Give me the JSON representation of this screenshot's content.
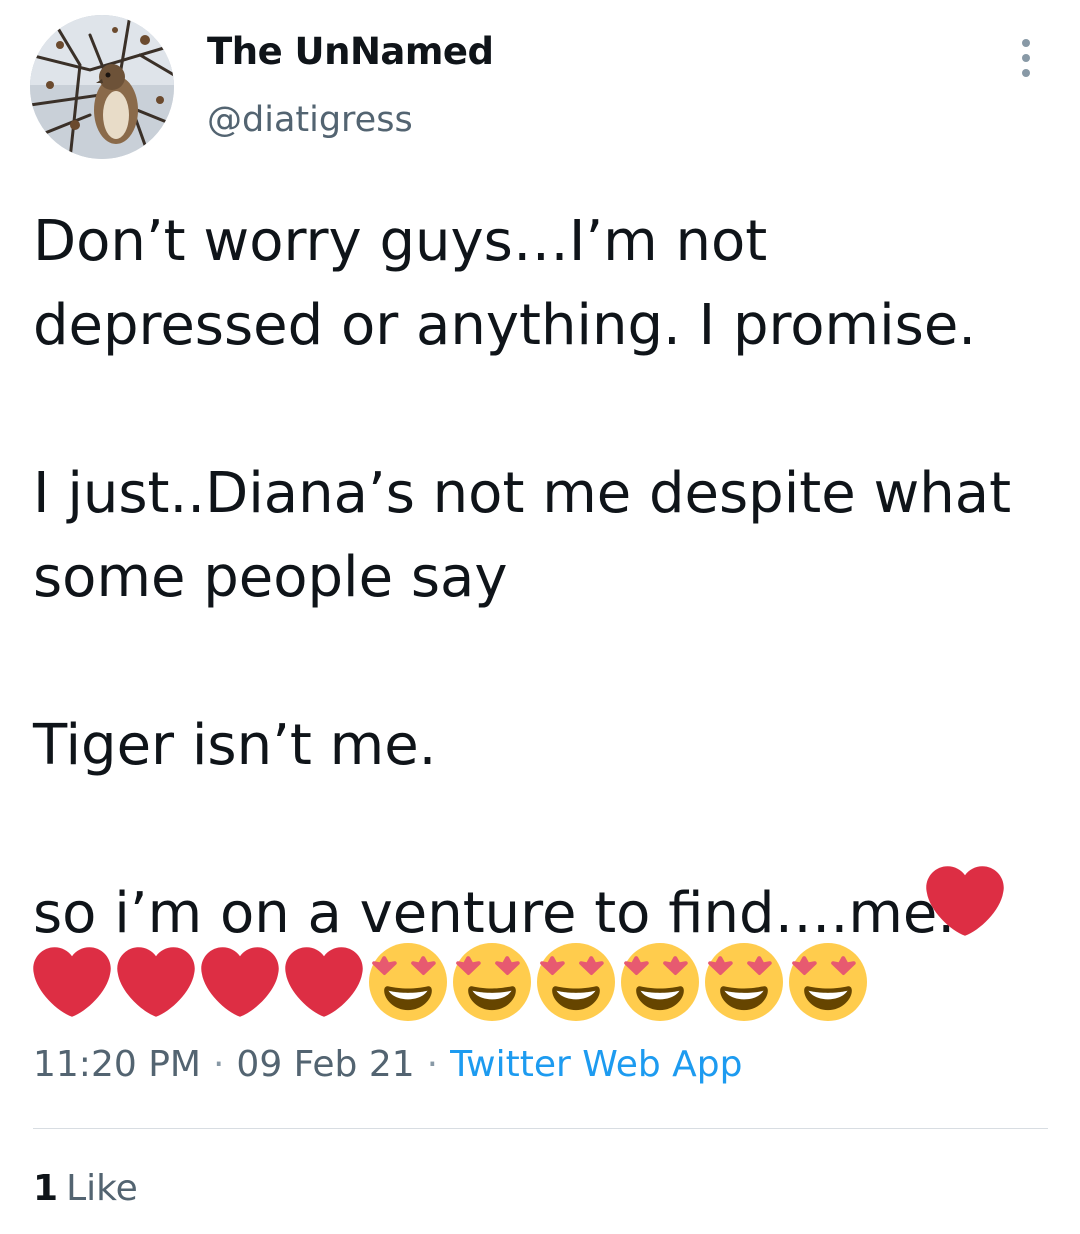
{
  "author": {
    "display_name": "The UnNamed",
    "handle": "@diatigress"
  },
  "tweet": {
    "text": "Don’t worry guys…I’m not depressed or anything. I promise.\n\nI just..Diana’s not me despite what some people say\n\nTiger isn’t me.\n\nso i’m on a venture to find….me.",
    "emoji_sequence": [
      "red-heart",
      "red-heart",
      "red-heart",
      "red-heart",
      "red-heart",
      "heart-eyes",
      "heart-eyes",
      "heart-eyes",
      "heart-eyes",
      "heart-eyes",
      "heart-eyes"
    ]
  },
  "meta": {
    "time": "11:20 PM",
    "separator": "·",
    "date": "09 Feb 21",
    "source": "Twitter Web App"
  },
  "engagement": {
    "like_count": "1",
    "like_label": "Like"
  },
  "icons": {
    "more": "more-vertical-icon"
  },
  "colors": {
    "text": "#0f1419",
    "secondary": "#536471",
    "link": "#1d9bf0",
    "heart": "#dd2e44",
    "emoji_face": "#ffcc4d"
  }
}
